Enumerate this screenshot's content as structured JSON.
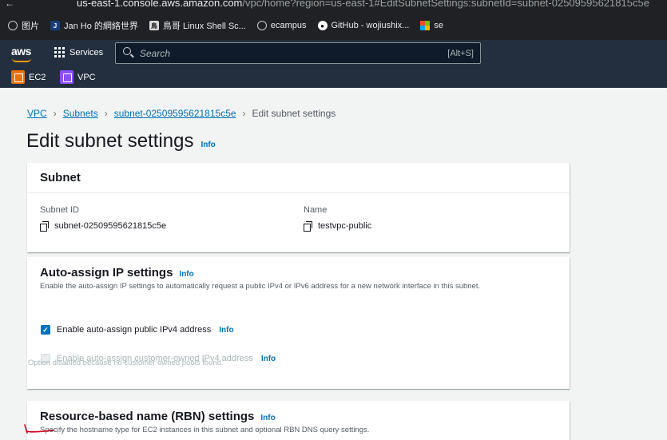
{
  "browser": {
    "url_host": "us-east-1.console.aws.amazon.com",
    "url_path": "/vpc/home?region=us-east-1#EditSubnetSettings:subnetId=subnet-02509595621815c5e",
    "bookmarks": [
      {
        "label": "图片",
        "icon": "globe-icon"
      },
      {
        "label": "Jan Ho 的網絡世界",
        "icon": "j-icon"
      },
      {
        "label": "鳥哥 Linux Shell Sc...",
        "icon": "book-icon"
      },
      {
        "label": "ecampus",
        "icon": "globe-icon"
      },
      {
        "label": "GitHub - wojiushix...",
        "icon": "github-icon"
      },
      {
        "label": "se",
        "icon": "microsoft-icon"
      }
    ]
  },
  "aws_nav": {
    "logo": "aws",
    "services_label": "Services",
    "search_placeholder": "Search",
    "search_shortcut": "[Alt+S]",
    "favorites": [
      {
        "label": "EC2",
        "color": "#ed7100"
      },
      {
        "label": "VPC",
        "color": "#8c4fff"
      }
    ]
  },
  "breadcrumb": {
    "items": [
      "VPC",
      "Subnets",
      "subnet-02509595621815c5e"
    ],
    "current": "Edit subnet settings"
  },
  "page": {
    "title": "Edit subnet settings",
    "info": "Info"
  },
  "subnet_card": {
    "title": "Subnet",
    "id_label": "Subnet ID",
    "id_value": "subnet-02509595621815c5e",
    "name_label": "Name",
    "name_value": "testvpc-public"
  },
  "auto_assign": {
    "title": "Auto-assign IP settings",
    "info": "Info",
    "description": "Enable the auto-assign IP settings to automatically request a public IPv4 or IPv6 address for a new network interface in this subnet.",
    "ipv4_label": "Enable auto-assign public IPv4 address",
    "ipv4_checked": true,
    "ipv4_info": "Info",
    "coip_label": "Enable auto-assign customer-owned IPv4 address",
    "coip_checked": false,
    "coip_info": "Info",
    "coip_note": "Option disabled because no customer owned pools found."
  },
  "rbn": {
    "title": "Resource-based name (RBN) settings",
    "info": "Info",
    "description": "Specify the hostname type for EC2 instances in this subnet and optional RBN DNS query settings."
  },
  "colors": {
    "aws_nav_bg": "#232f3e",
    "link": "#0073bb",
    "page_bg": "#f2f3f3",
    "annotation": "#d0021b"
  }
}
